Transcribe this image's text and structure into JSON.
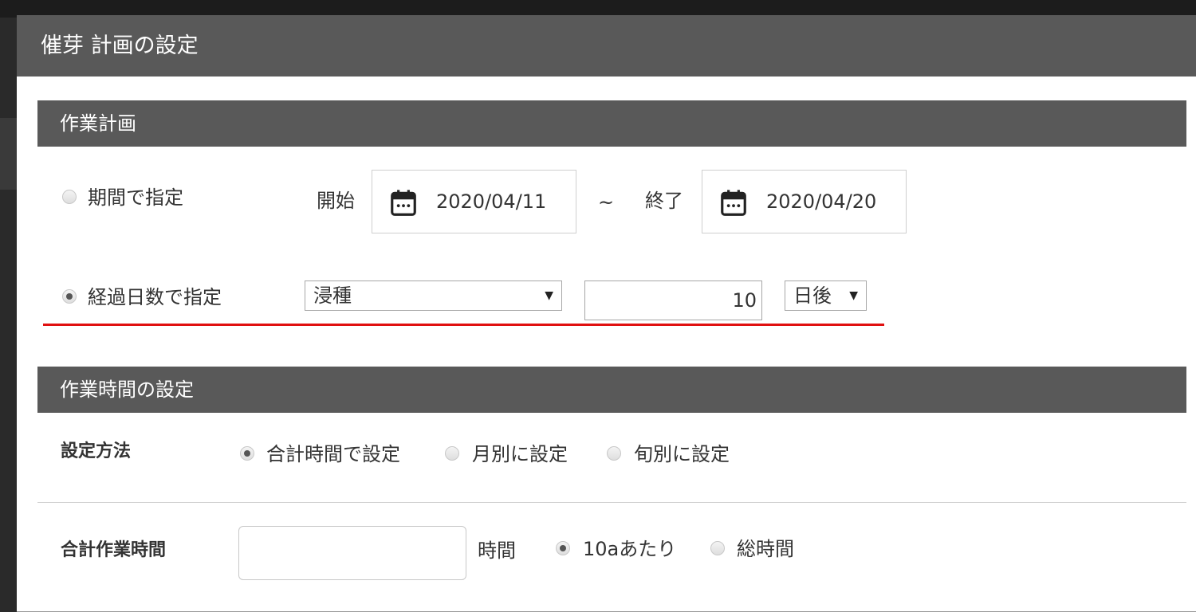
{
  "dialog": {
    "title": "催芽 計画の設定"
  },
  "work_plan": {
    "section_title": "作業計画",
    "by_period": {
      "label": "期間で指定",
      "checked": false,
      "start_label": "開始",
      "start_date": "2020/04/11",
      "separator": "~",
      "end_label": "終了",
      "end_date": "2020/04/20"
    },
    "by_days": {
      "label": "経過日数で指定",
      "checked": true,
      "base_option": "浸種",
      "days_value": "10",
      "unit_option": "日後"
    }
  },
  "work_time": {
    "section_title": "作業時間の設定",
    "method": {
      "label": "設定方法",
      "options": [
        {
          "label": "合計時間で設定",
          "checked": true
        },
        {
          "label": "月別に設定",
          "checked": false
        },
        {
          "label": "旬別に設定",
          "checked": false
        }
      ]
    },
    "total": {
      "label": "合計作業時間",
      "value": "",
      "unit": "時間",
      "options": [
        {
          "label": "10aあたり",
          "checked": true
        },
        {
          "label": "総時間",
          "checked": false
        }
      ]
    }
  },
  "icons": {
    "calendar": "calendar-icon",
    "dropdown": "triangle-down"
  },
  "colors": {
    "header_bg": "#595959",
    "highlight_line": "#e01010"
  }
}
